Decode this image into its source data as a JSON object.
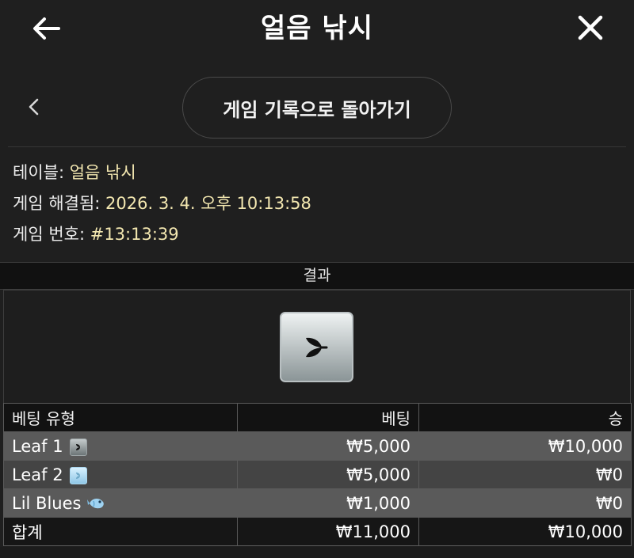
{
  "header": {
    "title": "얼음 낚시",
    "back_icon": "arrow-left-icon",
    "close_icon": "close-icon"
  },
  "nav": {
    "back_to_history_label": "게임 기록으로 돌아가기",
    "chevron_icon": "chevron-left-icon"
  },
  "info": {
    "table_label": "테이블: ",
    "table_value": "얼음 낚시",
    "resolved_label": "게임 해결됨: ",
    "resolved_value": "2026. 3. 4. 오후 10:13:58",
    "game_no_label": "게임 번호: ",
    "game_no_value": "#13:13:39"
  },
  "result": {
    "label": "결과",
    "tile_icon": "leaf-symbol-icon"
  },
  "bets_table": {
    "headers": [
      "베팅 유형",
      "베팅",
      "승"
    ],
    "rows": [
      {
        "type": "Leaf 1",
        "icon": "leaf-1-icon",
        "bet": "₩5,000",
        "win": "₩10,000"
      },
      {
        "type": "Leaf 2",
        "icon": "leaf-2-icon",
        "bet": "₩5,000",
        "win": "₩0"
      },
      {
        "type": "Lil Blues",
        "icon": "fish-icon",
        "bet": "₩1,000",
        "win": "₩0"
      }
    ],
    "total": {
      "label": "합계",
      "bet": "₩11,000",
      "win": "₩10,000"
    }
  },
  "colors": {
    "background": "#1f1f1f",
    "value_text": "#f3e7b0",
    "row_odd": "#5a5a5a",
    "row_even": "#444444"
  }
}
